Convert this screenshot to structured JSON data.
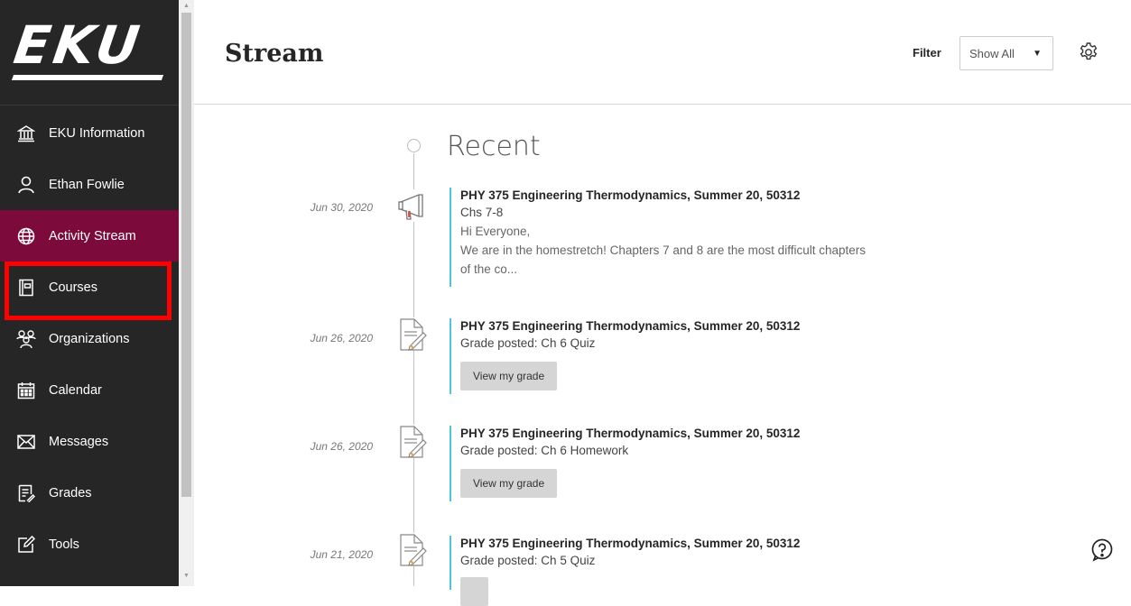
{
  "sidebar": {
    "logo": "EKU",
    "items": [
      {
        "label": "EKU Information",
        "icon": "institution-icon"
      },
      {
        "label": "Ethan Fowlie",
        "icon": "user-icon"
      },
      {
        "label": "Activity Stream",
        "icon": "globe-icon"
      },
      {
        "label": "Courses",
        "icon": "courses-icon"
      },
      {
        "label": "Organizations",
        "icon": "organizations-icon"
      },
      {
        "label": "Calendar",
        "icon": "calendar-icon"
      },
      {
        "label": "Messages",
        "icon": "envelope-icon"
      },
      {
        "label": "Grades",
        "icon": "grades-icon"
      },
      {
        "label": "Tools",
        "icon": "tools-icon"
      }
    ]
  },
  "header": {
    "title": "Stream",
    "filter_label": "Filter",
    "filter_value": "Show All"
  },
  "stream": {
    "section_title": "Recent",
    "entries": [
      {
        "date": "Jun 30, 2020",
        "icon": "announcement-icon",
        "course": "PHY 375 Engineering Thermodynamics, Summer 20, 50312",
        "subject": "Chs 7-8",
        "body1": "Hi Everyone,",
        "body2": "We are in the homestretch! Chapters 7 and 8 are the most difficult chapters of the co..."
      },
      {
        "date": "Jun 26, 2020",
        "icon": "grade-document-icon",
        "course": "PHY 375 Engineering Thermodynamics, Summer 20, 50312",
        "subject": "Grade posted: Ch 6 Quiz",
        "button": "View my grade"
      },
      {
        "date": "Jun 26, 2020",
        "icon": "grade-document-icon",
        "course": "PHY 375 Engineering Thermodynamics, Summer 20, 50312",
        "subject": "Grade posted: Ch 6 Homework",
        "button": "View my grade"
      },
      {
        "date": "Jun 21, 2020",
        "icon": "grade-document-icon",
        "course": "PHY 375 Engineering Thermodynamics, Summer 20, 50312",
        "subject": "Grade posted: Ch 5 Quiz"
      }
    ]
  },
  "colors": {
    "sidebar_bg": "#262626",
    "active_bg": "#7c0a3a",
    "highlight": "#ff0000",
    "timeline_accent": "#4cc6d6"
  }
}
